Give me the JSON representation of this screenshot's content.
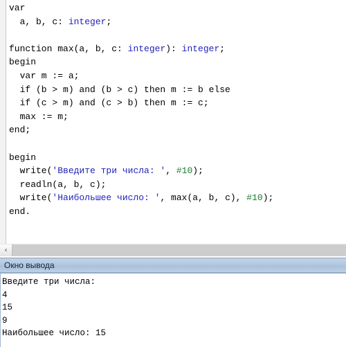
{
  "editor": {
    "name": "pascal-code-editor",
    "lines": [
      [
        {
          "t": "var",
          "c": "kw"
        }
      ],
      [
        {
          "t": "  a, b, c: ",
          "c": "plain"
        },
        {
          "t": "integer",
          "c": "type"
        },
        {
          "t": ";",
          "c": "plain"
        }
      ],
      [
        {
          "t": "",
          "c": "plain"
        }
      ],
      [
        {
          "t": "function max(a, b, c: ",
          "c": "plain"
        },
        {
          "t": "integer",
          "c": "type"
        },
        {
          "t": "): ",
          "c": "plain"
        },
        {
          "t": "integer",
          "c": "type"
        },
        {
          "t": ";",
          "c": "plain"
        }
      ],
      [
        {
          "t": "begin",
          "c": "kw"
        }
      ],
      [
        {
          "t": "  var m := a;",
          "c": "plain"
        }
      ],
      [
        {
          "t": "  if (b > m) and (b > c) then m := b else",
          "c": "plain"
        }
      ],
      [
        {
          "t": "  if (c > m) and (c > b) then m := c;",
          "c": "plain"
        }
      ],
      [
        {
          "t": "  max := m;",
          "c": "plain"
        }
      ],
      [
        {
          "t": "end;",
          "c": "kw"
        }
      ],
      [
        {
          "t": "",
          "c": "plain"
        }
      ],
      [
        {
          "t": "begin",
          "c": "kw"
        }
      ],
      [
        {
          "t": "  write(",
          "c": "plain"
        },
        {
          "t": "'Введите три числа: '",
          "c": "str"
        },
        {
          "t": ", ",
          "c": "plain"
        },
        {
          "t": "#10",
          "c": "num"
        },
        {
          "t": ");",
          "c": "plain"
        }
      ],
      [
        {
          "t": "  readln(a, b, c);",
          "c": "plain"
        }
      ],
      [
        {
          "t": "  write(",
          "c": "plain"
        },
        {
          "t": "'Наибольшее число: '",
          "c": "str"
        },
        {
          "t": ", max(a, b, c), ",
          "c": "plain"
        },
        {
          "t": "#10",
          "c": "num"
        },
        {
          "t": ");",
          "c": "plain"
        }
      ],
      [
        {
          "t": "end.",
          "c": "kw"
        }
      ]
    ]
  },
  "scrollbar": {
    "left_arrow_glyph": "‹"
  },
  "output": {
    "title": "Окно вывода",
    "lines": [
      "Введите три числа:",
      "4",
      "15",
      "9",
      "Наибольшее число: 15"
    ]
  },
  "colors": {
    "keyword": "#000000",
    "type": "#2222bb",
    "string": "#2222bb",
    "number": "#1a7a2e",
    "output_header_bg": "#b3c8e0",
    "scrollbar_track": "#cdcdcd"
  }
}
